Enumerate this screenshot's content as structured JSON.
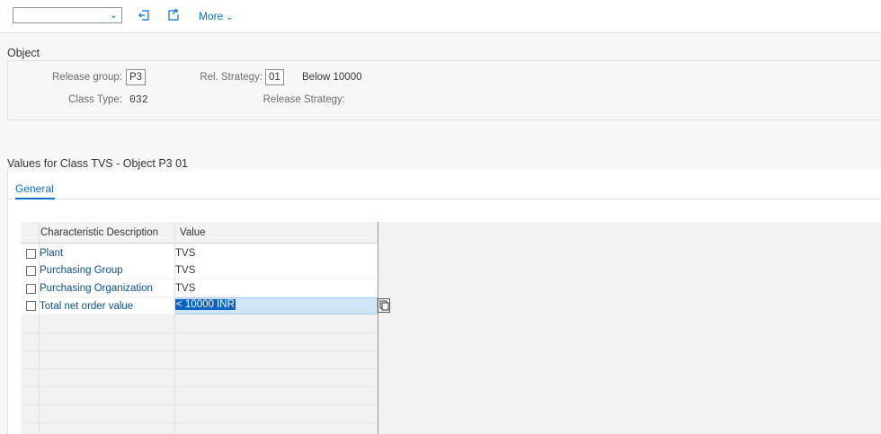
{
  "toolbar": {
    "dropdown_value": "",
    "more_label": "More"
  },
  "object_section": {
    "title": "Object",
    "release_group_label": "Release group:",
    "release_group_value": "P3",
    "rel_strategy_label": "Rel. Strategy:",
    "rel_strategy_value": "01",
    "rel_strategy_desc": "Below 10000",
    "class_type_label": "Class Type:",
    "class_type_value": "032",
    "release_strategy_label": "Release Strategy:"
  },
  "values_section": {
    "title": "Values for Class TVS - Object P3 01",
    "tab_general": "General",
    "columns": [
      "Characteristic Description",
      "Value"
    ],
    "rows": [
      {
        "desc": "Plant",
        "value": "TVS"
      },
      {
        "desc": "Purchasing Group",
        "value": "TVS"
      },
      {
        "desc": "Purchasing Organization",
        "value": "TVS"
      },
      {
        "desc": "Total net order value",
        "value": "< 10000 INR"
      }
    ]
  },
  "icons": {
    "back": "exit-icon",
    "forward": "export-icon",
    "copy": "copy-icon"
  },
  "colors": {
    "accent": "#0a6ed1",
    "selection": "#0b63c6"
  }
}
